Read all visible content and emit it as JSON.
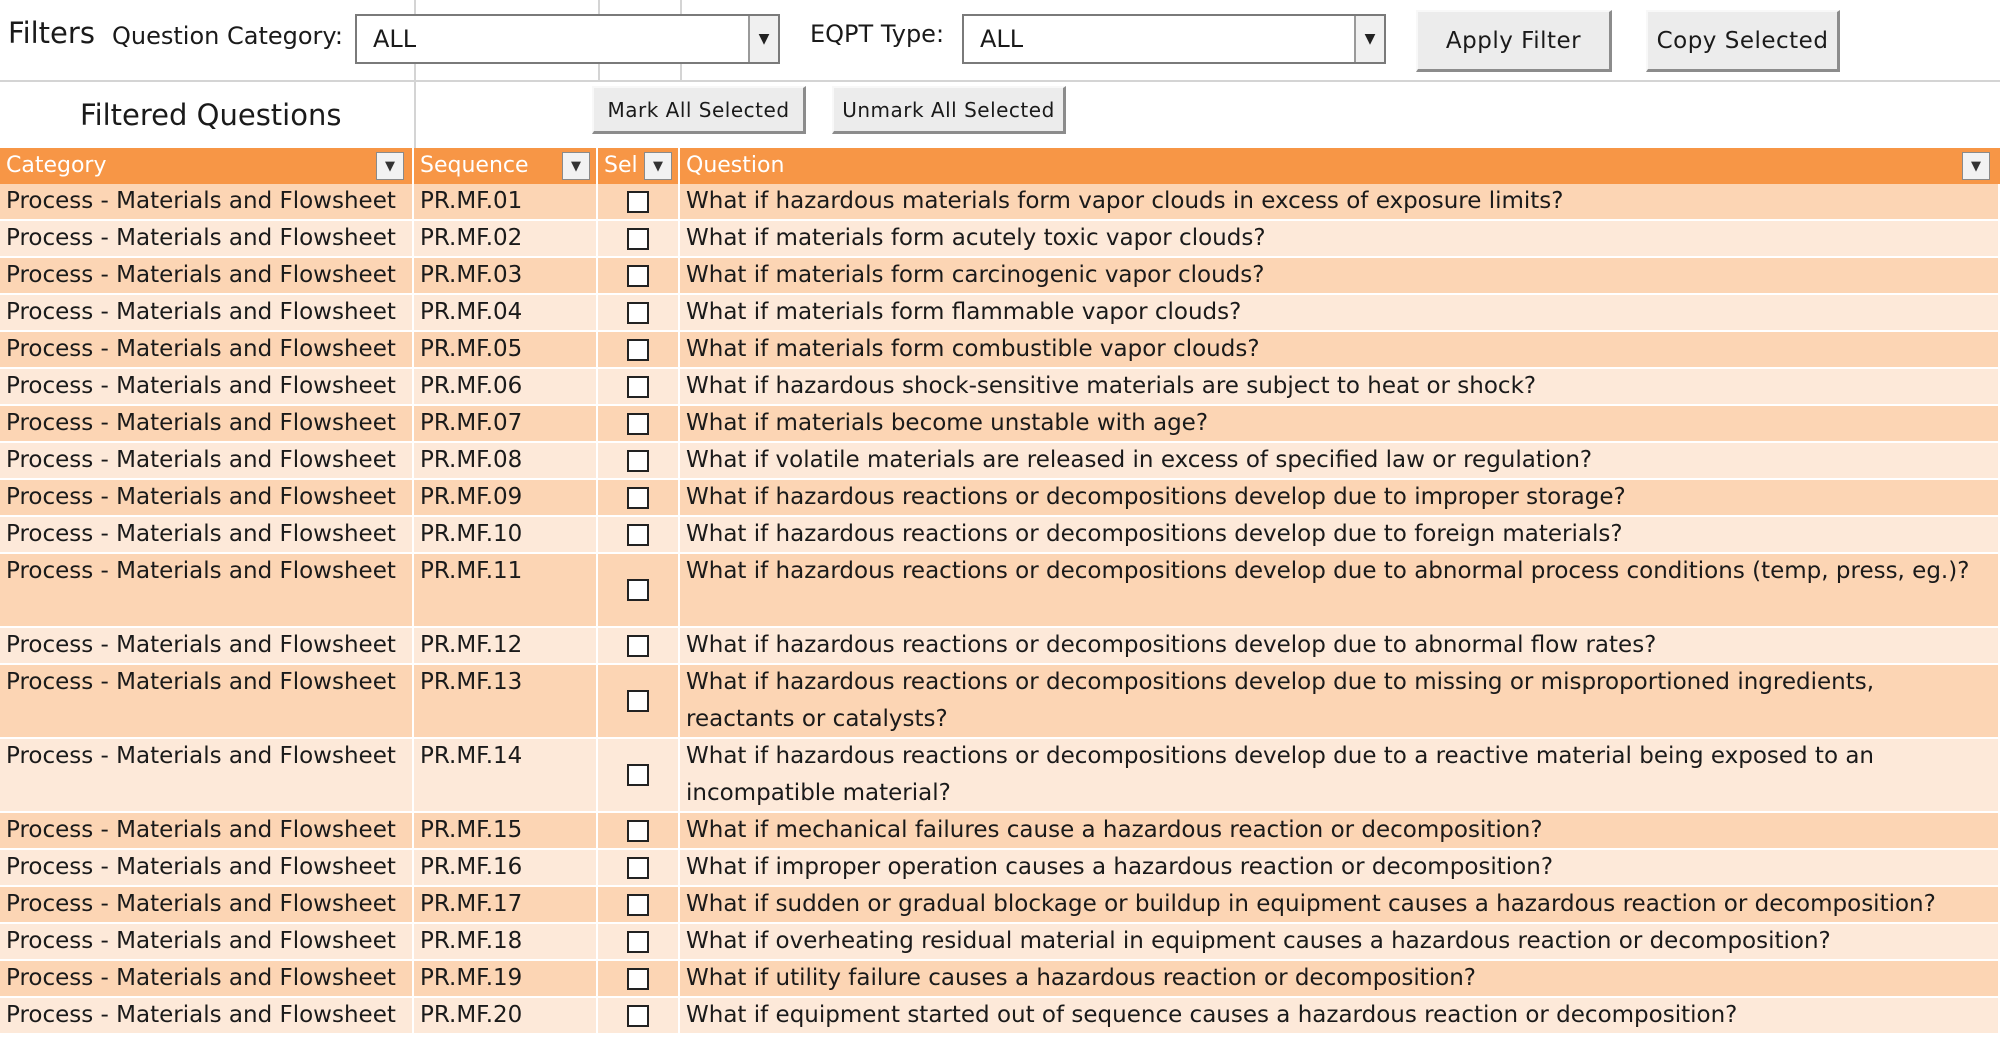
{
  "filters": {
    "title": "Filters",
    "category_label": "Question Category:",
    "category_value": "ALL",
    "eqpt_label": "EQPT Type:",
    "eqpt_value": "ALL",
    "apply_label": "Apply Filter",
    "copy_label": "Copy Selected"
  },
  "section": {
    "title": "Filtered Questions",
    "mark_all_label": "Mark All Selected",
    "unmark_all_label": "Unmark All Selected"
  },
  "table": {
    "headers": {
      "category": "Category",
      "sequence": "Sequence",
      "sel": "Sel",
      "question": "Question"
    },
    "rows": [
      {
        "category": "Process - Materials and Flowsheet",
        "sequence": "PR.MF.01",
        "selected": false,
        "question": "What if hazardous materials form vapor clouds in excess of exposure limits?"
      },
      {
        "category": "Process - Materials and Flowsheet",
        "sequence": "PR.MF.02",
        "selected": false,
        "question": "What if materials form acutely toxic vapor clouds?"
      },
      {
        "category": "Process - Materials and Flowsheet",
        "sequence": "PR.MF.03",
        "selected": false,
        "question": "What if materials form carcinogenic vapor clouds?"
      },
      {
        "category": "Process - Materials and Flowsheet",
        "sequence": "PR.MF.04",
        "selected": false,
        "question": "What if materials form flammable vapor clouds?"
      },
      {
        "category": "Process - Materials and Flowsheet",
        "sequence": "PR.MF.05",
        "selected": false,
        "question": "What if materials form combustible vapor clouds?"
      },
      {
        "category": "Process - Materials and Flowsheet",
        "sequence": "PR.MF.06",
        "selected": false,
        "question": "What if hazardous shock-sensitive materials are subject to heat or shock?"
      },
      {
        "category": "Process - Materials and Flowsheet",
        "sequence": "PR.MF.07",
        "selected": false,
        "question": "What if materials become unstable with age?"
      },
      {
        "category": "Process - Materials and Flowsheet",
        "sequence": "PR.MF.08",
        "selected": false,
        "question": "What if volatile materials are released in excess of specified law or regulation?"
      },
      {
        "category": "Process - Materials and Flowsheet",
        "sequence": "PR.MF.09",
        "selected": false,
        "question": "What if hazardous reactions or decompositions develop due to improper storage?"
      },
      {
        "category": "Process - Materials and Flowsheet",
        "sequence": "PR.MF.10",
        "selected": false,
        "question": "What if hazardous reactions or decompositions develop due to foreign materials?"
      },
      {
        "category": "Process - Materials and Flowsheet",
        "sequence": "PR.MF.11",
        "selected": false,
        "question": "What if hazardous reactions or decompositions develop due to abnormal process conditions (temp, press, eg.)?"
      },
      {
        "category": "Process - Materials and Flowsheet",
        "sequence": "PR.MF.12",
        "selected": false,
        "question": "What if hazardous reactions or decompositions develop due to abnormal flow rates?"
      },
      {
        "category": "Process - Materials and Flowsheet",
        "sequence": "PR.MF.13",
        "selected": false,
        "question": "What if hazardous reactions or decompositions develop due to missing or misproportioned ingredients, reactants or catalysts?"
      },
      {
        "category": "Process - Materials and Flowsheet",
        "sequence": "PR.MF.14",
        "selected": false,
        "question": "What if hazardous reactions or decompositions develop due to a reactive material being exposed to an incompatible material?"
      },
      {
        "category": "Process - Materials and Flowsheet",
        "sequence": "PR.MF.15",
        "selected": false,
        "question": "What if mechanical failures cause a hazardous reaction or decomposition?"
      },
      {
        "category": "Process - Materials and Flowsheet",
        "sequence": "PR.MF.16",
        "selected": false,
        "question": "What if improper operation causes a hazardous reaction or decomposition?"
      },
      {
        "category": "Process - Materials and Flowsheet",
        "sequence": "PR.MF.17",
        "selected": false,
        "question": "What if sudden or gradual blockage or buildup in equipment causes a hazardous reaction or decomposition?"
      },
      {
        "category": "Process - Materials and Flowsheet",
        "sequence": "PR.MF.18",
        "selected": false,
        "question": "What if overheating residual material in equipment causes a hazardous reaction or decomposition?"
      },
      {
        "category": "Process - Materials and Flowsheet",
        "sequence": "PR.MF.19",
        "selected": false,
        "question": "What if utility failure causes a hazardous reaction or decomposition?"
      },
      {
        "category": "Process - Materials and Flowsheet",
        "sequence": "PR.MF.20",
        "selected": false,
        "question": "What if equipment started out of sequence causes a hazardous reaction or decomposition?"
      }
    ]
  },
  "colors": {
    "header_bg": "#f79646",
    "row_odd": "#fcd5b4",
    "row_even": "#fde9d9"
  },
  "icons": {
    "combo_dropdown": "triangle-down-icon",
    "column_filter": "filter-dropdown-icon",
    "row_checkbox": "checkbox-icon"
  }
}
